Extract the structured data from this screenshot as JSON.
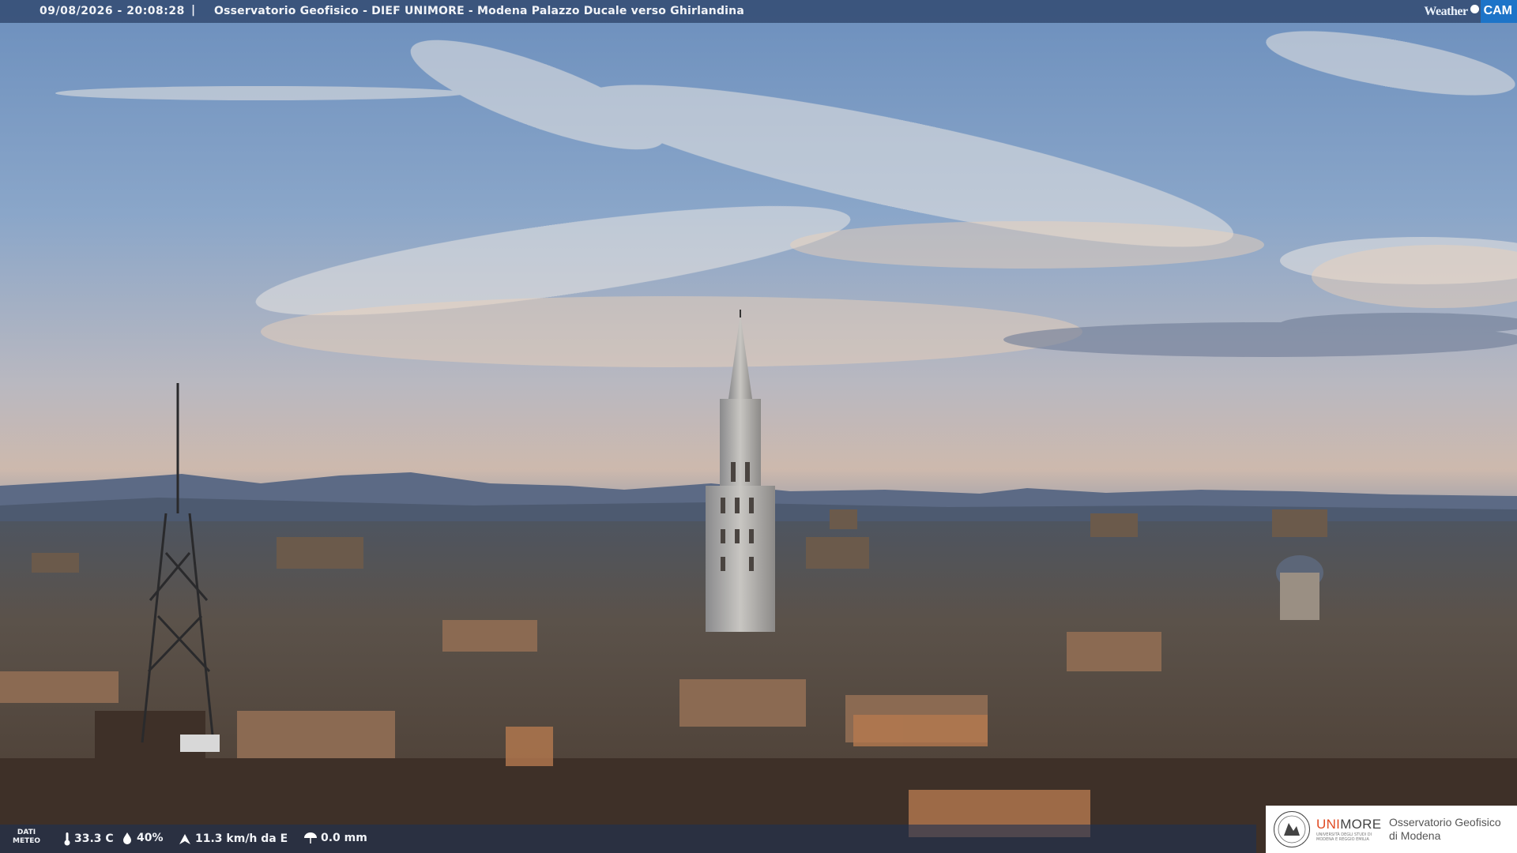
{
  "header": {
    "datetime": "09/08/2026 - 20:08:28",
    "separator": "|",
    "title": "Osservatorio Geofisico - DIEF UNIMORE - Modena Palazzo Ducale verso Ghirlandina"
  },
  "brand": {
    "weather": "Weather",
    "cam": "CAM"
  },
  "footer": {
    "dati_line1": "DATI",
    "dati_line2": "METEO",
    "temperature": "33.3 C",
    "humidity": "40%",
    "wind": "11.3 km/h da E",
    "rain": "0.0 mm"
  },
  "logo": {
    "uni_prefix": "UNI",
    "uni_suffix": "MORE",
    "uni_subtitle": "UNIVERSITÀ DEGLI STUDI DI MODENA E REGGIO EMILIA",
    "observatory_line1": "Osservatorio Geofisico",
    "observatory_line2": "di Modena"
  },
  "colors": {
    "brand_blue": "#1d74c8",
    "unimore_orange": "#e04a22",
    "bar_bg": "#283e64"
  }
}
